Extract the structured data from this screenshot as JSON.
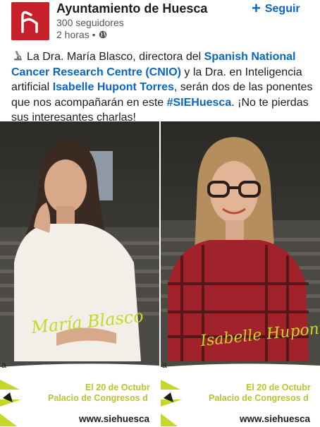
{
  "header": {
    "org_name": "Ayuntamiento de Huesca",
    "followers": "300 seguidores",
    "time": "2 horas •",
    "follow_label": "Seguir",
    "follow_icon": "plus-icon",
    "logo_icon": "huesca-h-logo",
    "visibility_icon": "globe-icon"
  },
  "post": {
    "emoji_icon": "microscope-emoji",
    "t1": "La Dra. María Blasco, directora del ",
    "link1": "Spanish National Cancer Research Centre (CNIO)",
    "t2": " y la Dra. en Inteligencia artificial ",
    "link2": "Isabelle Hupont Torres",
    "t3": ", serán dos de las ponentes que nos acompañarán en este ",
    "hashtag": "#SIEHuesca",
    "t4": ". ¡No te pierdas sus interesantes charlas!"
  },
  "images": [
    {
      "signature": "María Blasco",
      "banner_letter": "a",
      "date": "El 20 de Octubr",
      "place": "Palacio de Congresos d",
      "url": "www.siehuesca"
    },
    {
      "signature": "Isabelle Hupont",
      "banner_letter": "a",
      "date": "El 20 de Octubr",
      "place": "Palacio de Congresos d",
      "url": "www.siehuesca"
    }
  ],
  "colors": {
    "brand_red": "#c8202a",
    "link_blue": "#0a66c2",
    "event_yellow": "#c7d62a"
  }
}
